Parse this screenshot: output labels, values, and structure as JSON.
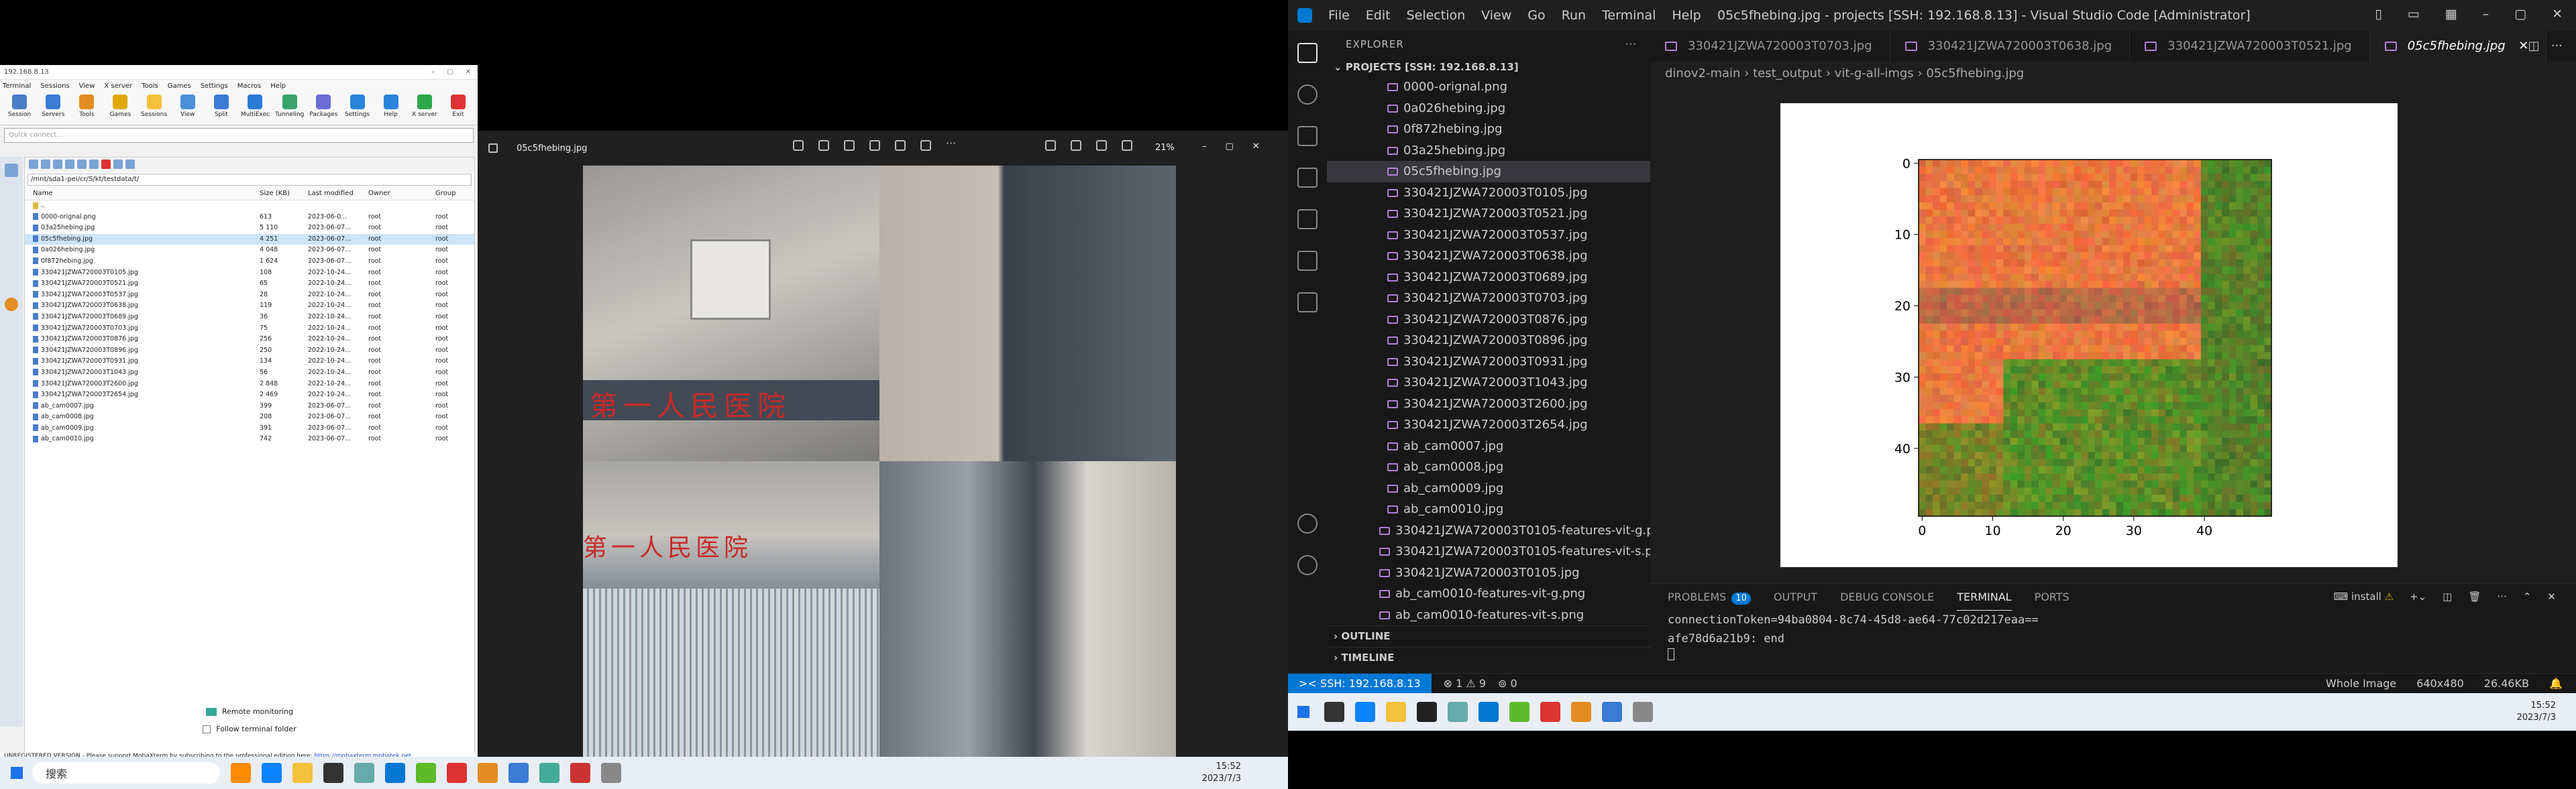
{
  "moba": {
    "title": "192.168.8.13",
    "menu": [
      "Terminal",
      "Sessions",
      "View",
      "X server",
      "Tools",
      "Games",
      "Settings",
      "Macros",
      "Help"
    ],
    "toolbar": [
      "Session",
      "Servers",
      "Tools",
      "Games",
      "Sessions",
      "View",
      "Split",
      "MultiExec",
      "Tunneling",
      "Packages",
      "Settings",
      "Help",
      "X server",
      "Exit"
    ],
    "quick_connect": "Quick connect...",
    "path": "/mnt/sda1-pei/cr/S/kt/testdata/t/",
    "columns": [
      "Name",
      "Size (KB)",
      "Last modified",
      "Owner",
      "Group"
    ],
    "files": [
      {
        "name": "..",
        "size": "",
        "date": "",
        "owner": "",
        "group": ""
      },
      {
        "name": "0000-orignal.png",
        "size": "613",
        "date": "2023-06-0...",
        "owner": "root",
        "group": "root"
      },
      {
        "name": "03a25hebing.jpg",
        "size": "5 110",
        "date": "2023-06-07...",
        "owner": "root",
        "group": "root"
      },
      {
        "name": "05c5fhebing.jpg",
        "size": "4 251",
        "date": "2023-06-07...",
        "owner": "root",
        "group": "root"
      },
      {
        "name": "0a026hebing.jpg",
        "size": "4 048",
        "date": "2023-06-07...",
        "owner": "root",
        "group": "root"
      },
      {
        "name": "0f872hebing.jpg",
        "size": "1 624",
        "date": "2023-06-07...",
        "owner": "root",
        "group": "root"
      },
      {
        "name": "330421JZWA720003T0105.jpg",
        "size": "108",
        "date": "2022-10-24...",
        "owner": "root",
        "group": "root"
      },
      {
        "name": "330421JZWA720003T0521.jpg",
        "size": "65",
        "date": "2022-10-24...",
        "owner": "root",
        "group": "root"
      },
      {
        "name": "330421JZWA720003T0537.jpg",
        "size": "28",
        "date": "2022-10-24...",
        "owner": "root",
        "group": "root"
      },
      {
        "name": "330421JZWA720003T0638.jpg",
        "size": "119",
        "date": "2022-10-24...",
        "owner": "root",
        "group": "root"
      },
      {
        "name": "330421JZWA720003T0689.jpg",
        "size": "36",
        "date": "2022-10-24...",
        "owner": "root",
        "group": "root"
      },
      {
        "name": "330421JZWA720003T0703.jpg",
        "size": "75",
        "date": "2022-10-24...",
        "owner": "root",
        "group": "root"
      },
      {
        "name": "330421JZWA720003T0876.jpg",
        "size": "256",
        "date": "2022-10-24...",
        "owner": "root",
        "group": "root"
      },
      {
        "name": "330421JZWA720003T0896.jpg",
        "size": "250",
        "date": "2022-10-24...",
        "owner": "root",
        "group": "root"
      },
      {
        "name": "330421JZWA720003T0931.jpg",
        "size": "134",
        "date": "2022-10-24...",
        "owner": "root",
        "group": "root"
      },
      {
        "name": "330421JZWA720003T1043.jpg",
        "size": "56",
        "date": "2022-10-24...",
        "owner": "root",
        "group": "root"
      },
      {
        "name": "330421JZWA720003T2600.jpg",
        "size": "2 848",
        "date": "2022-10-24...",
        "owner": "root",
        "group": "root"
      },
      {
        "name": "330421JZWA720003T2654.jpg",
        "size": "2 469",
        "date": "2022-10-24...",
        "owner": "root",
        "group": "root"
      },
      {
        "name": "ab_cam0007.jpg",
        "size": "399",
        "date": "2023-06-07...",
        "owner": "root",
        "group": "root"
      },
      {
        "name": "ab_cam0008.jpg",
        "size": "208",
        "date": "2023-06-07...",
        "owner": "root",
        "group": "root"
      },
      {
        "name": "ab_cam0009.jpg",
        "size": "391",
        "date": "2023-06-07...",
        "owner": "root",
        "group": "root"
      },
      {
        "name": "ab_cam0010.jpg",
        "size": "742",
        "date": "2023-06-07...",
        "owner": "root",
        "group": "root"
      }
    ],
    "remote_monitoring": "Remote monitoring",
    "follow_folder": "Follow terminal folder",
    "unreg_text": "UNREGISTERED VERSION  -  Please support MobaXterm by subscribing to the professional edition here:",
    "unreg_link": "https://mobaxterm.mobatek.net"
  },
  "viewer": {
    "filename": "05c5fhebing.jpg",
    "zoom": "21%",
    "sign_text": "第一人民医院"
  },
  "taskbar_left": {
    "search": "搜索",
    "time": "15:52",
    "date": "2023/7/3"
  },
  "vscode": {
    "menu": [
      "File",
      "Edit",
      "Selection",
      "View",
      "Go",
      "Run",
      "Terminal",
      "Help"
    ],
    "title": "05c5fhebing.jpg - projects [SSH: 192.168.8.13] - Visual Studio Code [Administrator]",
    "explorer_label": "EXPLORER",
    "project_label": "PROJECTS [SSH: 192.168.8.13]",
    "tree": [
      {
        "name": "0000-orignal.png",
        "sel": false,
        "indent": 1
      },
      {
        "name": "0a026hebing.jpg",
        "sel": false,
        "indent": 1
      },
      {
        "name": "0f872hebing.jpg",
        "sel": false,
        "indent": 1
      },
      {
        "name": "03a25hebing.jpg",
        "sel": false,
        "indent": 1
      },
      {
        "name": "05c5fhebing.jpg",
        "sel": true,
        "indent": 1
      },
      {
        "name": "330421JZWA720003T0105.jpg",
        "sel": false,
        "indent": 1
      },
      {
        "name": "330421JZWA720003T0521.jpg",
        "sel": false,
        "indent": 1
      },
      {
        "name": "330421JZWA720003T0537.jpg",
        "sel": false,
        "indent": 1
      },
      {
        "name": "330421JZWA720003T0638.jpg",
        "sel": false,
        "indent": 1
      },
      {
        "name": "330421JZWA720003T0689.jpg",
        "sel": false,
        "indent": 1
      },
      {
        "name": "330421JZWA720003T0703.jpg",
        "sel": false,
        "indent": 1
      },
      {
        "name": "330421JZWA720003T0876.jpg",
        "sel": false,
        "indent": 1
      },
      {
        "name": "330421JZWA720003T0896.jpg",
        "sel": false,
        "indent": 1
      },
      {
        "name": "330421JZWA720003T0931.jpg",
        "sel": false,
        "indent": 1
      },
      {
        "name": "330421JZWA720003T1043.jpg",
        "sel": false,
        "indent": 1
      },
      {
        "name": "330421JZWA720003T2600.jpg",
        "sel": false,
        "indent": 1
      },
      {
        "name": "330421JZWA720003T2654.jpg",
        "sel": false,
        "indent": 1
      },
      {
        "name": "ab_cam0007.jpg",
        "sel": false,
        "indent": 1
      },
      {
        "name": "ab_cam0008.jpg",
        "sel": false,
        "indent": 1
      },
      {
        "name": "ab_cam0009.jpg",
        "sel": false,
        "indent": 1
      },
      {
        "name": "ab_cam0010.jpg",
        "sel": false,
        "indent": 1
      },
      {
        "name": "330421JZWA720003T0105-features-vit-g.png",
        "sel": false,
        "indent": 0
      },
      {
        "name": "330421JZWA720003T0105-features-vit-s.png",
        "sel": false,
        "indent": 0
      },
      {
        "name": "330421JZWA720003T0105.jpg",
        "sel": false,
        "indent": 0
      },
      {
        "name": "ab_cam0010-features-vit-g.png",
        "sel": false,
        "indent": 0
      },
      {
        "name": "ab_cam0010-features-vit-s.png",
        "sel": false,
        "indent": 0
      }
    ],
    "outline": "OUTLINE",
    "timeline": "TIMELINE",
    "tabs": [
      "330421JZWA720003T0703.jpg",
      "330421JZWA720003T0638.jpg",
      "330421JZWA720003T0521.jpg",
      "05c5fhebing.jpg"
    ],
    "breadcrumb": [
      "dinov2-main",
      "test_output",
      "vit-g-all-imgs",
      "05c5fhebing.jpg"
    ],
    "panel_tabs": [
      "PROBLEMS",
      "OUTPUT",
      "DEBUG CONSOLE",
      "TERMINAL",
      "PORTS"
    ],
    "problems_count": "10",
    "terminal_lines": [
      "connectionToken=94ba0804-8c74-45d8-ae64-77c02d217eaa==",
      "afe78d6a21b9: end"
    ],
    "terminal_task": "install",
    "status": {
      "remote": "SSH: 192.168.8.13",
      "errors": "1",
      "warnings": "9",
      "ports": "0",
      "zoom": "Whole Image",
      "dims": "640x480",
      "size": "26.46KB"
    },
    "taskbar_time": "15:52",
    "taskbar_date": "2023/7/3"
  },
  "chart_data": {
    "type": "heatmap",
    "x_ticks": [
      "0",
      "10",
      "20",
      "30",
      "40"
    ],
    "y_ticks": [
      "0",
      "10",
      "20",
      "30",
      "40"
    ],
    "grid_cols": 50,
    "grid_rows": 50,
    "xlim": [
      0,
      50
    ],
    "ylim": [
      0,
      50
    ],
    "colors": {
      "orange": "#e8703a",
      "red": "#c85a3f",
      "green": "#3f7d2c",
      "dark_green": "#2a5a22"
    }
  }
}
